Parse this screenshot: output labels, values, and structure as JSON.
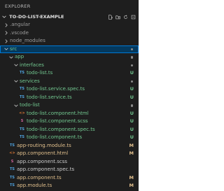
{
  "panel": {
    "title": "EXPLORER"
  },
  "project": {
    "name": "TO-DO-LIST-EXAMPLE"
  },
  "colors": {
    "untracked": "#73c991",
    "modified": "#e2c08d",
    "selection": "#04395e"
  },
  "tree": [
    {
      "label": "angular",
      "prefix": ".",
      "indent": 0,
      "chevron": "right",
      "icon": "",
      "status": "",
      "dot": false,
      "color": "gray",
      "name": "folder-angular"
    },
    {
      "label": "vscode",
      "prefix": ".",
      "indent": 0,
      "chevron": "right",
      "icon": "",
      "status": "",
      "dot": false,
      "color": "gray",
      "name": "folder-vscode"
    },
    {
      "label": "node_modules",
      "prefix": "",
      "indent": 0,
      "chevron": "right",
      "icon": "",
      "status": "",
      "dot": false,
      "color": "gray",
      "name": "folder-node-modules"
    },
    {
      "label": "src",
      "prefix": "",
      "indent": 0,
      "chevron": "down",
      "icon": "",
      "status": "",
      "dot": true,
      "color": "green",
      "selected": true,
      "name": "folder-src"
    },
    {
      "label": "app",
      "prefix": "",
      "indent": 1,
      "chevron": "down",
      "icon": "",
      "status": "",
      "dot": true,
      "color": "green",
      "name": "folder-app"
    },
    {
      "label": "interfaces",
      "prefix": "",
      "indent": 2,
      "chevron": "down",
      "icon": "",
      "status": "",
      "dot": true,
      "color": "green",
      "name": "folder-interfaces"
    },
    {
      "label": "todo-list.ts",
      "prefix": "",
      "indent": 3,
      "chevron": "",
      "icon": "TS",
      "status": "U",
      "dot": false,
      "color": "green",
      "name": "file-todo-list-ts"
    },
    {
      "label": "services",
      "prefix": "",
      "indent": 2,
      "chevron": "down",
      "icon": "",
      "status": "",
      "dot": true,
      "color": "green",
      "name": "folder-services"
    },
    {
      "label": "todo-list.service.spec.ts",
      "prefix": "",
      "indent": 3,
      "chevron": "",
      "icon": "TS",
      "status": "U",
      "dot": false,
      "color": "green",
      "name": "file-service-spec-ts"
    },
    {
      "label": "todo-list.service.ts",
      "prefix": "",
      "indent": 3,
      "chevron": "",
      "icon": "TS",
      "status": "U",
      "dot": false,
      "color": "green",
      "name": "file-service-ts"
    },
    {
      "label": "todo-list",
      "prefix": "",
      "indent": 2,
      "chevron": "down",
      "icon": "",
      "status": "",
      "dot": true,
      "color": "green",
      "name": "folder-todo-list"
    },
    {
      "label": "todo-list.component.html",
      "prefix": "",
      "indent": 3,
      "chevron": "",
      "icon": "<>",
      "status": "U",
      "dot": false,
      "color": "green",
      "name": "file-component-html"
    },
    {
      "label": "todo-list.component.scss",
      "prefix": "",
      "indent": 3,
      "chevron": "",
      "icon": "S",
      "status": "U",
      "dot": false,
      "color": "green",
      "name": "file-component-scss"
    },
    {
      "label": "todo-list.component.spec.ts",
      "prefix": "",
      "indent": 3,
      "chevron": "",
      "icon": "TS",
      "status": "U",
      "dot": false,
      "color": "green",
      "name": "file-component-spec-ts"
    },
    {
      "label": "todo-list.component.ts",
      "prefix": "",
      "indent": 3,
      "chevron": "",
      "icon": "TS",
      "status": "U",
      "dot": false,
      "color": "green",
      "name": "file-component-ts"
    },
    {
      "label": "app-routing.module.ts",
      "prefix": "",
      "indent": 1,
      "chevron": "",
      "icon": "TS",
      "status": "M",
      "dot": false,
      "color": "olive",
      "name": "file-app-routing-module-ts"
    },
    {
      "label": "app.component.html",
      "prefix": "",
      "indent": 1,
      "chevron": "",
      "icon": "<>",
      "status": "M",
      "dot": false,
      "color": "olive",
      "name": "file-app-component-html"
    },
    {
      "label": "app.component.scss",
      "prefix": "",
      "indent": 1,
      "chevron": "",
      "icon": "S",
      "status": "",
      "dot": false,
      "color": "gray-light",
      "name": "file-app-component-scss"
    },
    {
      "label": "app.component.spec.ts",
      "prefix": "",
      "indent": 1,
      "chevron": "",
      "icon": "TS",
      "status": "",
      "dot": false,
      "color": "gray-light",
      "name": "file-app-component-spec-ts"
    },
    {
      "label": "app.component.ts",
      "prefix": "",
      "indent": 1,
      "chevron": "",
      "icon": "TS",
      "status": "M",
      "dot": false,
      "color": "olive",
      "name": "file-app-component-ts"
    },
    {
      "label": "app.module.ts",
      "prefix": "",
      "indent": 1,
      "chevron": "",
      "icon": "TS",
      "status": "M",
      "dot": false,
      "color": "olive",
      "name": "file-app-module-ts"
    }
  ]
}
